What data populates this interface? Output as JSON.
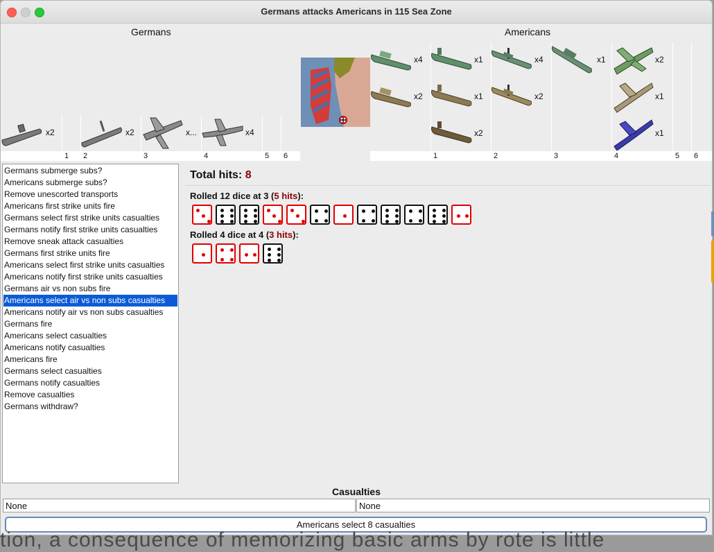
{
  "window": {
    "title": "Germans attacks Americans in 115 Sea Zone"
  },
  "attacker": {
    "name": "Germans",
    "units": [
      {
        "icon": "submarine-icon",
        "count": "x2",
        "color": "#7b7b7b"
      },
      {
        "icon": "submarine-icon",
        "count": "x2",
        "color": "#7b7b7b"
      },
      {
        "icon": "fighter-plane-icon",
        "count": "x...",
        "color": "#8a8a8a"
      },
      {
        "icon": "bomber-plane-icon",
        "count": "x4",
        "color": "#8a8a8a"
      }
    ],
    "axis": [
      "1",
      "2",
      "3",
      "4",
      "5",
      "6"
    ]
  },
  "defender": {
    "name": "Americans",
    "units": [
      {
        "icon": "transport-ship-icon",
        "count": "x4",
        "color": "#5f8f6b"
      },
      {
        "icon": "submarine-icon",
        "count": "x1",
        "color": "#5f8f6b"
      },
      {
        "icon": "destroyer-icon",
        "count": "x4",
        "color": "#6b8f73"
      },
      {
        "icon": "battleship-icon",
        "count": "x1",
        "color": "#6b8f73"
      },
      {
        "icon": "fighter-plane-icon",
        "count": "x2",
        "color": "#6e9b62"
      },
      {
        "icon": "transport-ship-icon",
        "count": "x2",
        "color": "#8c7a55"
      },
      {
        "icon": "submarine-icon",
        "count": "x1",
        "color": "#8c7a55"
      },
      {
        "icon": "destroyer-icon",
        "count": "x2",
        "color": "#9c8a5c"
      },
      {
        "icon": "fighter-plane-icon",
        "count": "x1",
        "color": "#a89a78"
      },
      {
        "icon": "submarine-icon",
        "count": "x2",
        "color": "#6e5b3a"
      },
      {
        "icon": "fighter-plane-icon",
        "count": "x1",
        "color": "#3a3aa8"
      }
    ],
    "axis": [
      "1",
      "2",
      "3",
      "4",
      "5",
      "6"
    ]
  },
  "territory": {
    "icon": "sea-zone-map-icon"
  },
  "steps": [
    "Germans submerge subs?",
    "Americans submerge subs?",
    "Remove unescorted transports",
    "Americans first strike units fire",
    "Germans select first strike units casualties",
    "Germans notify first strike units casualties",
    "Remove sneak attack casualties",
    "Germans first strike units fire",
    "Americans select first strike units casualties",
    "Americans notify first strike units casualties",
    "Germans air vs non subs fire",
    "Americans select air vs non subs casualties",
    "Americans notify air vs non subs casualties",
    "Germans fire",
    "Americans select casualties",
    "Americans notify casualties",
    "Americans fire",
    "Germans select casualties",
    "Germans notify casualties",
    "Remove casualties",
    "Germans withdraw?"
  ],
  "selected_step": 11,
  "results": {
    "total_label": "Total hits:",
    "total_value": "8",
    "rolls": [
      {
        "prefix": "Rolled 12 dice at 3 (",
        "hits": "5 hits",
        "suffix": "):",
        "dice": [
          3,
          6,
          6,
          3,
          3,
          4,
          1,
          4,
          6,
          4,
          6,
          2
        ],
        "hit_flags": [
          true,
          false,
          false,
          true,
          true,
          false,
          true,
          false,
          false,
          false,
          false,
          true
        ]
      },
      {
        "prefix": "Rolled 4 dice at 4 (",
        "hits": "3 hits",
        "suffix": "):",
        "dice": [
          1,
          4,
          2,
          6
        ],
        "hit_flags": [
          true,
          true,
          true,
          false
        ]
      }
    ]
  },
  "casualties": {
    "title": "Casualties",
    "left": "None",
    "right": "None"
  },
  "status": "Americans select 8 casualties",
  "background_text": "tion, a consequence of memorizing basic arms by rote is little",
  "colors": {
    "hit": "#e00000",
    "hits_text": "#8b0000",
    "selection": "#0b5bd6"
  }
}
